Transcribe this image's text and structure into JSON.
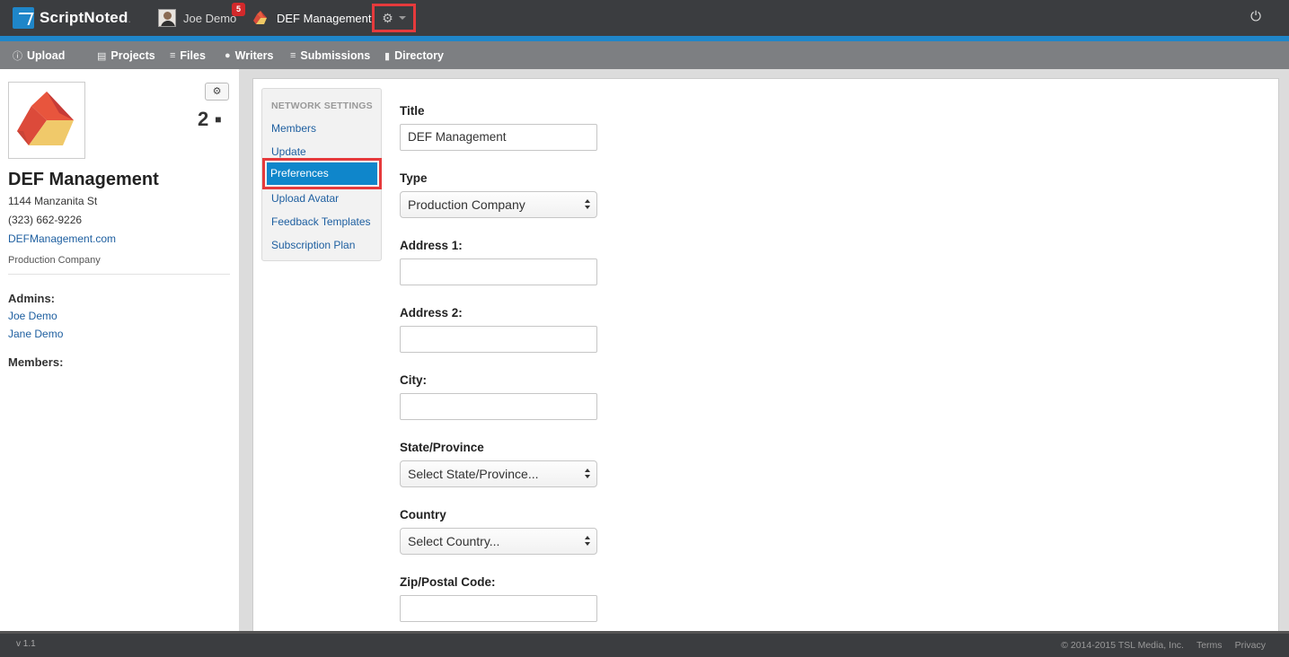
{
  "topbar": {
    "brand": "ScriptNoted",
    "brand_suffix": ".",
    "user_name": "Joe Demo",
    "notification_count": "5",
    "org_name": "DEF Management"
  },
  "subnav": {
    "items": [
      {
        "icon": "upload-icon",
        "label": "Upload"
      },
      {
        "icon": "folder-icon",
        "label": "Projects"
      },
      {
        "icon": "layers-icon",
        "label": "Files"
      },
      {
        "icon": "user-icon",
        "label": "Writers"
      },
      {
        "icon": "layers-icon",
        "label": "Submissions"
      },
      {
        "icon": "book-icon",
        "label": "Directory"
      }
    ]
  },
  "sidebar": {
    "member_count": "2",
    "org_name": "DEF Management",
    "address": "1144 Manzanita St",
    "phone": "(323) 662-9226",
    "website": "DEFManagement.com",
    "org_type": "Production Company",
    "admins_heading": "Admins:",
    "admins": [
      "Joe Demo",
      "Jane Demo"
    ],
    "members_heading": "Members:"
  },
  "settings_nav": {
    "heading": "NETWORK SETTINGS",
    "items": [
      "Members",
      "Update",
      "Preferences",
      "Upload Avatar",
      "Feedback Templates",
      "Subscription Plan"
    ],
    "active": "Preferences"
  },
  "form": {
    "title_label": "Title",
    "title_value": "DEF Management",
    "type_label": "Type",
    "type_value": "Production Company",
    "address1_label": "Address 1:",
    "address1_value": "",
    "address2_label": "Address 2:",
    "address2_value": "",
    "city_label": "City:",
    "city_value": "",
    "state_label": "State/Province",
    "state_value": "Select State/Province...",
    "country_label": "Country",
    "country_value": "Select Country...",
    "zip_label": "Zip/Postal Code:",
    "zip_value": ""
  },
  "footer": {
    "version": "v 1.1",
    "copyright": "© 2014-2015 TSL Media, Inc.",
    "terms": "Terms",
    "privacy": "Privacy"
  },
  "colors": {
    "topbar": "#3b3d40",
    "accent": "#1f86c9",
    "subnav": "#7d7f82",
    "link": "#1e5fa0",
    "active_nav": "#0f86cb",
    "highlight_box": "#e63a3c",
    "badge": "#d2292b"
  }
}
